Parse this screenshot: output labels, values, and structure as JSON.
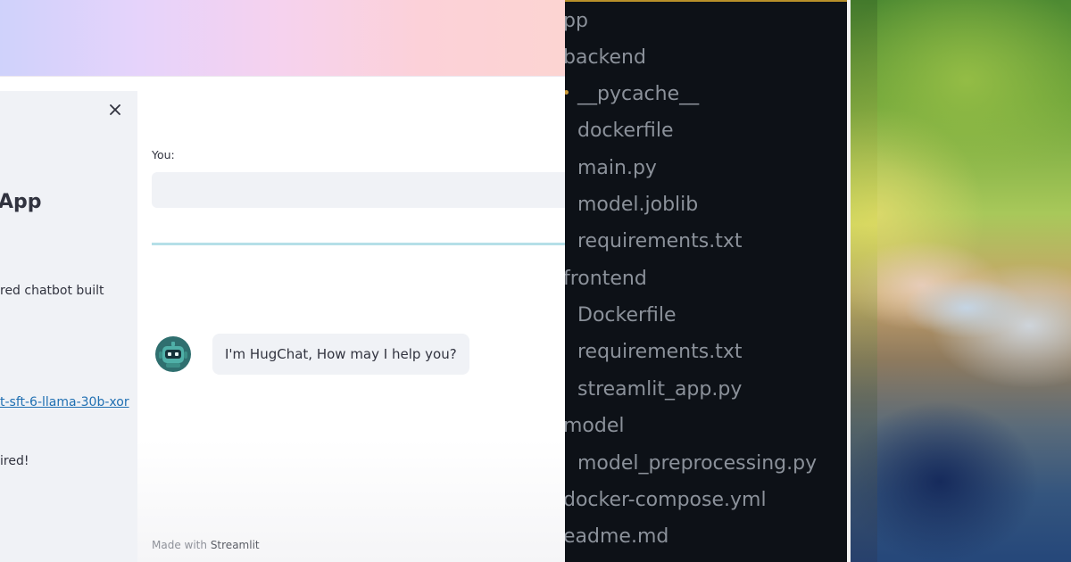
{
  "streamlit_app": {
    "sidebar": {
      "close_icon": "close-icon",
      "title": "App",
      "about_text": "red chatbot built",
      "model_link": "t-sft-6-llama-30b-xor",
      "footer_text": "ired!"
    },
    "main": {
      "input_label": "You:",
      "input_value": "",
      "bot_avatar_icon": "robot-icon",
      "bot_message": "I'm HugChat, How may I help you?",
      "footer_prefix": "Made with",
      "footer_brand": "Streamlit"
    }
  },
  "file_tree": {
    "items": [
      "pp",
      "backend",
      "__pycache__",
      "dockerfile",
      "main.py",
      "model.joblib",
      "requirements.txt",
      "frontend",
      "Dockerfile",
      "requirements.txt",
      "streamlit_app.py",
      "model",
      "model_preprocessing.py",
      "docker-compose.yml",
      "eadme.md"
    ]
  },
  "colors": {
    "accent_line": "#b5dfe8",
    "link": "#1f6fb2",
    "tree_text": "#8b919a",
    "tree_background": "#0d1117",
    "tree_marker": "#c99a3a"
  }
}
